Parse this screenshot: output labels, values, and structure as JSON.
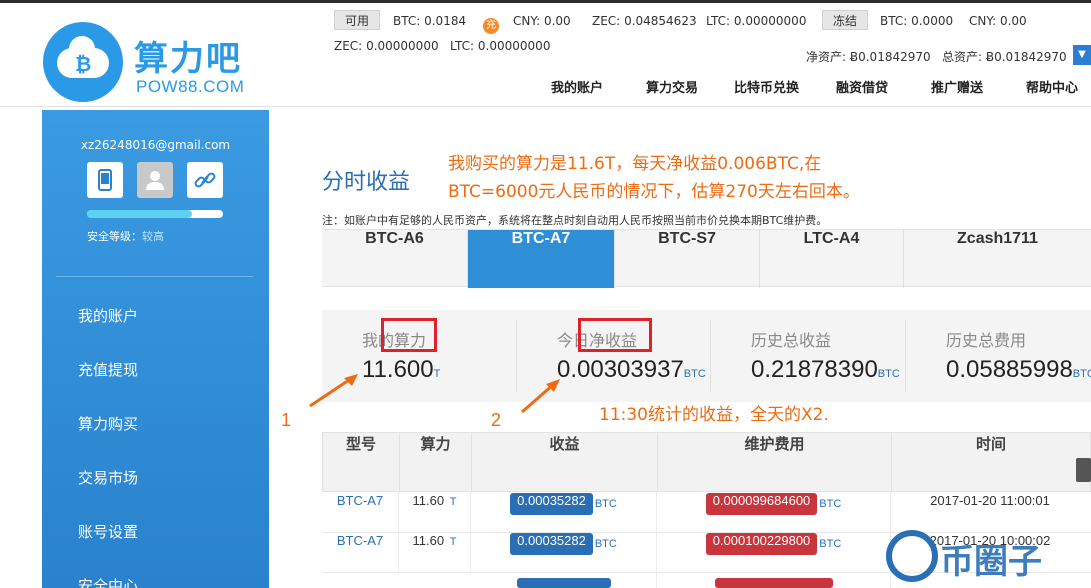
{
  "header": {
    "logo": {
      "name": "算力吧",
      "domain": "POW88.COM"
    },
    "wallet": {
      "available_tag": "可用",
      "available": [
        {
          "label": "BTC:",
          "value": "0.0184"
        },
        {
          "label": "CNY:",
          "value": "0.00"
        },
        {
          "label": "ZEC:",
          "value": "0.04854623"
        },
        {
          "label": "LTC:",
          "value": "0.00000000"
        }
      ],
      "recharge_icon": "充",
      "frozen_tag": "冻结",
      "frozen": [
        {
          "label": "BTC:",
          "value": "0.0000"
        },
        {
          "label": "CNY:",
          "value": "0.00"
        }
      ],
      "row2": [
        {
          "label": "ZEC:",
          "value": "0.00000000"
        },
        {
          "label": "LTC:",
          "value": "0.00000000"
        }
      ],
      "net_assets_label": "净资产:",
      "net_assets_value": "Ƀ0.01842970",
      "total_assets_label": "总资产:",
      "total_assets_value": "Ƀ0.01842970",
      "dropdown_icon": "▼"
    },
    "nav": [
      "我的账户",
      "算力交易",
      "比特币兑换",
      "融资借贷",
      "推广赠送",
      "帮助中心"
    ]
  },
  "sidebar": {
    "email": "xz26248016@gmail.com",
    "security_label": "安全等级：",
    "security_level": "较高",
    "security_progress": 0.77,
    "menu": [
      "我的账户",
      "充值提现",
      "算力购买",
      "交易市场",
      "账号设置",
      "安全中心"
    ]
  },
  "main": {
    "title": "分时收益",
    "annotation_line1": "我购买的算力是11.6T，每天净收益0.006BTC,在",
    "annotation_line2": "BTC=6000元人民币的情况下，估算270天左右回本。",
    "note": "注：如账户中有足够的人民币资产，系统将在整点时刻自动用人民币按照当前市价兑换本期BTC维护费。",
    "tabs": [
      "BTC-A6",
      "BTC-A7",
      "BTC-S7",
      "LTC-A4",
      "Zcash1711"
    ],
    "active_tab": 1,
    "stats": [
      {
        "label": "我的算力",
        "value": "11.600",
        "unit": "T"
      },
      {
        "label": "今日净收益",
        "value": "0.00303937",
        "unit": "BTC"
      },
      {
        "label": "历史总收益",
        "value": "0.21878390",
        "unit": "BTC"
      },
      {
        "label": "历史总费用",
        "value": "0.05885998",
        "unit": "BTC"
      }
    ],
    "callout_1": "1",
    "callout_2": "2",
    "annotation_stats": "11:30统计的收益，全天的X2.",
    "table": {
      "headers": [
        "型号",
        "算力",
        "收益",
        "维护费用",
        "时间"
      ],
      "rows": [
        {
          "model": "BTC-A7",
          "power": "11.60",
          "power_unit": "T",
          "income": "0.00035282",
          "income_unit": "BTC",
          "fee": "0.000099684600",
          "fee_unit": "BTC",
          "time": "2017-01-20 11:00:01"
        },
        {
          "model": "BTC-A7",
          "power": "11.60",
          "power_unit": "T",
          "income": "0.00035282",
          "income_unit": "BTC",
          "fee": "0.000100229800",
          "fee_unit": "BTC",
          "time": "2017-01-20 10:00:02"
        }
      ]
    }
  },
  "watermark": "币圈子",
  "colors": {
    "brand_blue": "#2a9ae6",
    "annotation_orange": "#ee6b12",
    "highlight_red": "#e0202a"
  }
}
